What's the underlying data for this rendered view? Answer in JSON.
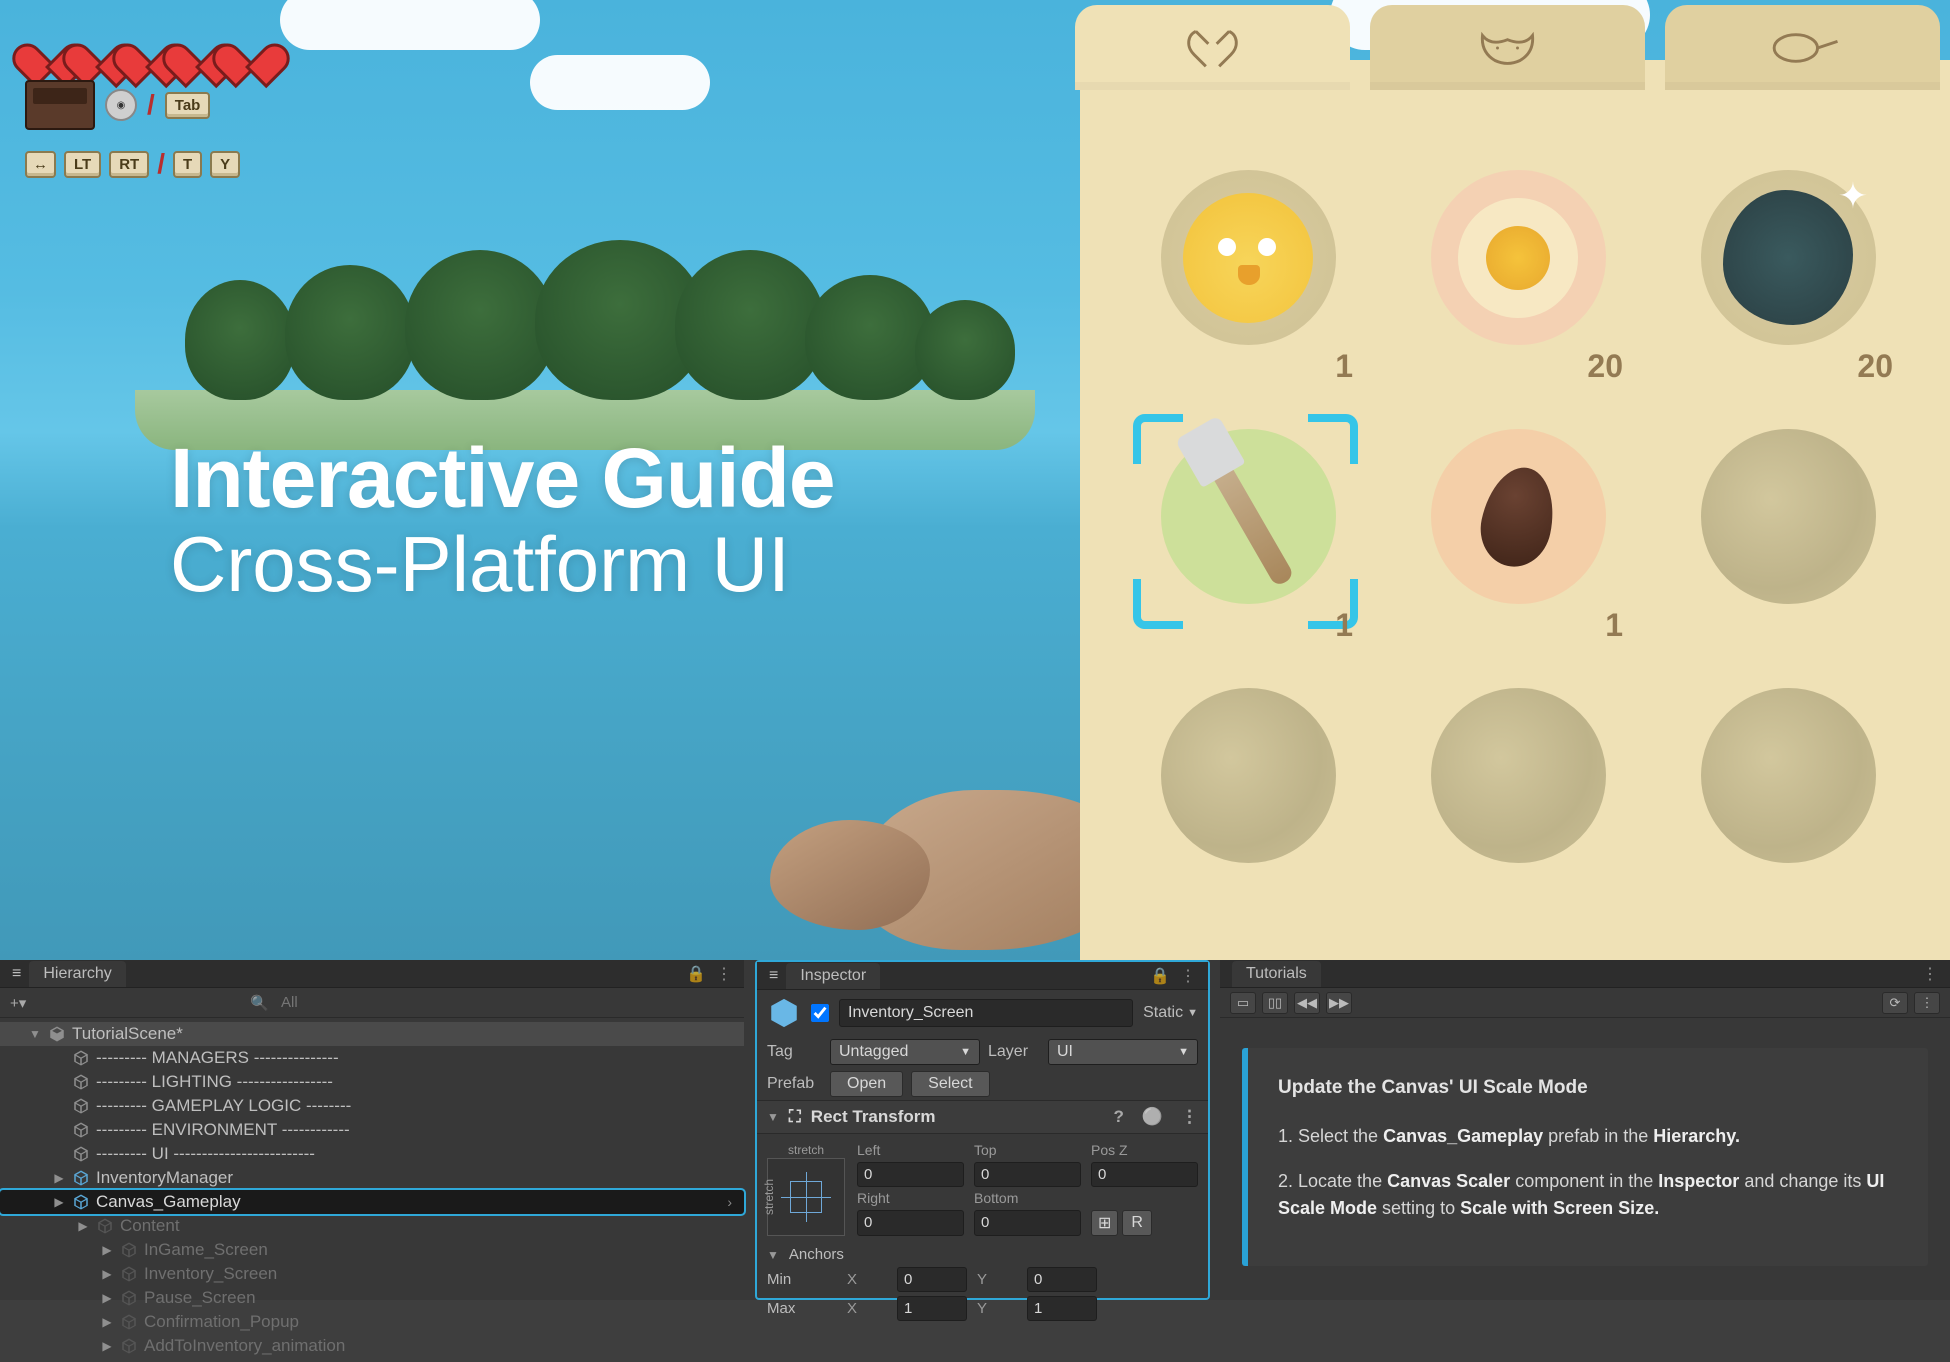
{
  "headline": {
    "title": "Interactive Guide",
    "subtitle": "Cross-Platform UI"
  },
  "hud": {
    "hearts": 5,
    "keys_row2": {
      "tab": "Tab"
    },
    "keys_row3": {
      "lt": "LT",
      "rt": "RT",
      "t": "T",
      "y": "Y"
    }
  },
  "inventory": {
    "tabs": [
      {
        "name": "craft",
        "active": true
      },
      {
        "name": "critters",
        "active": false
      },
      {
        "name": "cook",
        "active": false
      }
    ],
    "items": [
      {
        "name": "phoenix-chick",
        "count": "1"
      },
      {
        "name": "egg",
        "count": "20"
      },
      {
        "name": "thunder-rock",
        "count": "20"
      },
      {
        "name": "fork",
        "count": "1",
        "selected": true
      },
      {
        "name": "seed",
        "count": "1"
      },
      {
        "name": "empty"
      },
      {
        "name": "empty"
      },
      {
        "name": "empty"
      },
      {
        "name": "empty"
      }
    ]
  },
  "hierarchy": {
    "panel_title": "Hierarchy",
    "search_placeholder": "All",
    "root": "TutorialScene*",
    "nodes": [
      {
        "label": "--------- MANAGERS ---------------",
        "indent": 2
      },
      {
        "label": "--------- LIGHTING -----------------",
        "indent": 2
      },
      {
        "label": "--------- GAMEPLAY LOGIC --------",
        "indent": 2
      },
      {
        "label": "--------- ENVIRONMENT ------------",
        "indent": 2
      },
      {
        "label": "--------- UI -------------------------",
        "indent": 2
      },
      {
        "label": "InventoryManager",
        "indent": 2,
        "prefab": true,
        "expand": true
      },
      {
        "label": "Canvas_Gameplay",
        "indent": 2,
        "prefab": true,
        "selected": true,
        "expand": true,
        "chev": true
      },
      {
        "label": "Content",
        "indent": 3,
        "prefab": true,
        "dim": true,
        "expand": true
      },
      {
        "label": "InGame_Screen",
        "indent": 4,
        "prefab": true,
        "dim": true,
        "expand": true
      },
      {
        "label": "Inventory_Screen",
        "indent": 4,
        "prefab": true,
        "dim": true,
        "expand": true
      },
      {
        "label": "Pause_Screen",
        "indent": 4,
        "prefab": true,
        "dim": true,
        "expand": true
      },
      {
        "label": "Confirmation_Popup",
        "indent": 4,
        "prefab": true,
        "dim": true,
        "expand": true
      },
      {
        "label": "AddToInventory_animation",
        "indent": 4,
        "prefab": true,
        "dim": true,
        "expand": true
      }
    ]
  },
  "inspector": {
    "panel_title": "Inspector",
    "object_name": "Inventory_Screen",
    "enabled": true,
    "static_label": "Static",
    "tag_label": "Tag",
    "tag_value": "Untagged",
    "layer_label": "Layer",
    "layer_value": "UI",
    "prefab_label": "Prefab",
    "open_btn": "Open",
    "select_btn": "Select",
    "rect_transform": {
      "title": "Rect Transform",
      "stretch": "stretch",
      "left_label": "Left",
      "top_label": "Top",
      "posz_label": "Pos Z",
      "left": "0",
      "top": "0",
      "posz": "0",
      "right_label": "Right",
      "bottom_label": "Bottom",
      "right": "0",
      "bottom": "0",
      "anchors_label": "Anchors",
      "min_label": "Min",
      "max_label": "Max",
      "min_x": "0",
      "min_y": "0",
      "max_x": "1",
      "max_y": "1"
    }
  },
  "tutorials": {
    "panel_title": "Tutorials",
    "heading": "Update the Canvas' UI Scale Mode",
    "step1_pre": "1. Select the ",
    "step1_bold1": "Canvas_Gameplay",
    "step1_mid": " prefab in the ",
    "step1_bold2": "Hierarchy.",
    "step2_pre": "2. Locate the ",
    "step2_bold1": "Canvas Scaler",
    "step2_mid1": " component in the ",
    "step2_bold2": "Inspector",
    "step2_mid2": " and change its ",
    "step2_bold3": "UI Scale Mode",
    "step2_mid3": " setting to ",
    "step2_bold4": "Scale with Screen Size."
  }
}
